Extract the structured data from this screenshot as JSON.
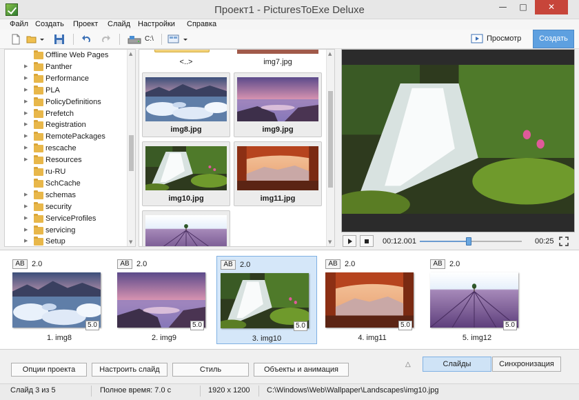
{
  "window": {
    "title": "Проект1 - PicturesToExe Deluxe",
    "minimize": "—",
    "maximize": "□",
    "close": "✕"
  },
  "menu": [
    "Файл",
    "Создать",
    "Проект",
    "Слайд",
    "Настройки",
    "Справка"
  ],
  "toolbar": {
    "drive_label": "C:\\",
    "preview_label": "Просмотр",
    "create_label": "Создать"
  },
  "tree": {
    "items": [
      {
        "label": "Offline Web Pages",
        "expandable": false
      },
      {
        "label": "Panther",
        "expandable": true
      },
      {
        "label": "Performance",
        "expandable": true
      },
      {
        "label": "PLA",
        "expandable": true
      },
      {
        "label": "PolicyDefinitions",
        "expandable": true
      },
      {
        "label": "Prefetch",
        "expandable": true
      },
      {
        "label": "Registration",
        "expandable": true
      },
      {
        "label": "RemotePackages",
        "expandable": true
      },
      {
        "label": "rescache",
        "expandable": true
      },
      {
        "label": "Resources",
        "expandable": true
      },
      {
        "label": "ru-RU",
        "expandable": false
      },
      {
        "label": "SchCache",
        "expandable": false
      },
      {
        "label": "schemas",
        "expandable": true
      },
      {
        "label": "security",
        "expandable": true
      },
      {
        "label": "ServiceProfiles",
        "expandable": true
      },
      {
        "label": "servicing",
        "expandable": true
      },
      {
        "label": "Setup",
        "expandable": true
      }
    ]
  },
  "files": {
    "parent_label": "<..>",
    "top_name": "img7.jpg",
    "tiles": [
      "img8.jpg",
      "img9.jpg",
      "img10.jpg",
      "img11.jpg"
    ]
  },
  "player": {
    "current_time": "00:12.001",
    "total_time": "00:25",
    "progress": 0.48
  },
  "slides": [
    {
      "name": "1. img8",
      "transition": "2.0",
      "duration": "5.0",
      "ab": "AB",
      "scene": "glacier"
    },
    {
      "name": "2. img9",
      "transition": "2.0",
      "duration": "5.0",
      "ab": "AB",
      "scene": "seashore"
    },
    {
      "name": "3. img10",
      "transition": "2.0",
      "duration": "5.0",
      "ab": "AB",
      "scene": "waterfall",
      "active": true
    },
    {
      "name": "4. img11",
      "transition": "2.0",
      "duration": "5.0",
      "ab": "AB",
      "scene": "arch"
    },
    {
      "name": "5. img12",
      "transition": "2.0",
      "duration": "5.0",
      "ab": "AB",
      "scene": "lavender"
    }
  ],
  "actions": [
    "Опции проекта",
    "Настроить слайд",
    "Стиль",
    "Объекты и анимация"
  ],
  "tabs": [
    "Слайды",
    "Синхронизация"
  ],
  "collapse_icon": "△",
  "status": {
    "slide_info": "Слайд 3 из 5",
    "total_time": "Полное время: 7.0 с",
    "resolution": "1920 x 1200",
    "path": "C:\\Windows\\Web\\Wallpaper\\Landscapes\\img10.jpg"
  }
}
